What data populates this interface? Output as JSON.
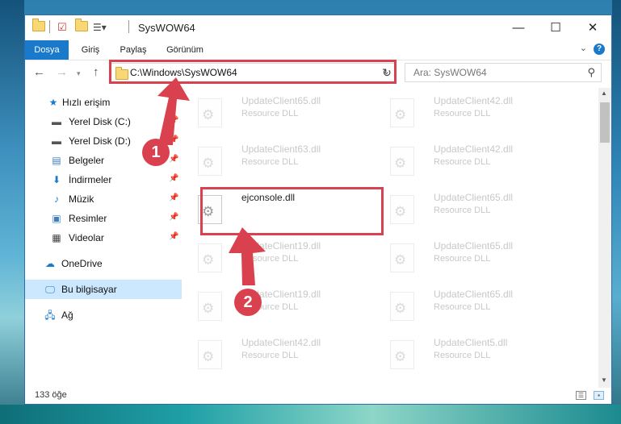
{
  "window": {
    "title": "SysWOW64"
  },
  "title_controls": {
    "minimize": "—",
    "maximize": "☐",
    "close": "✕"
  },
  "ribbon": {
    "tabs": [
      "Dosya",
      "Giriş",
      "Paylaş",
      "Görünüm"
    ],
    "active_tab": "Dosya",
    "help": "?"
  },
  "address": {
    "path": "C:\\Windows\\SysWOW64"
  },
  "search": {
    "placeholder": "Ara: SysWOW64"
  },
  "nav": {
    "items": [
      {
        "label": "Hızlı erişim"
      },
      {
        "label": "Yerel Disk (C:)"
      },
      {
        "label": "Yerel Disk (D:)"
      },
      {
        "label": "Belgeler"
      },
      {
        "label": "İndirmeler"
      },
      {
        "label": "Müzik"
      },
      {
        "label": "Resimler"
      },
      {
        "label": "Videolar"
      },
      {
        "label": "OneDrive"
      },
      {
        "label": "Bu bilgisayar"
      },
      {
        "label": "Ağ"
      }
    ],
    "selected": "Bu bilgisayar"
  },
  "files": {
    "left": [
      {
        "name": "UpdateClient65.dll",
        "desc": "Resource DLL"
      },
      {
        "name": "UpdateClient63.dll",
        "desc": "Resource DLL"
      },
      {
        "name": "ejconsole.dll",
        "desc": ""
      },
      {
        "name": "UpdateClient19.dll",
        "desc": "Resource DLL"
      },
      {
        "name": "UpdateClient19.dll",
        "desc": "Resource DLL"
      },
      {
        "name": "UpdateClient42.dll",
        "desc": "Resource DLL"
      }
    ],
    "right": [
      {
        "name": "UpdateClient42.dll",
        "desc": "Resource DLL"
      },
      {
        "name": "UpdateClient42.dll",
        "desc": "Resource DLL"
      },
      {
        "name": "UpdateClient65.dll",
        "desc": "Resource DLL"
      },
      {
        "name": "UpdateClient65.dll",
        "desc": "Resource DLL"
      },
      {
        "name": "UpdateClient65.dll",
        "desc": "Resource DLL"
      },
      {
        "name": "UpdateClient5.dll",
        "desc": "Resource DLL"
      }
    ]
  },
  "status": {
    "count": "133 öğe"
  },
  "callouts": {
    "one": "1",
    "two": "2"
  },
  "colors": {
    "accent": "#1979ca",
    "highlight": "#d9414e",
    "selection": "#cce8ff"
  }
}
